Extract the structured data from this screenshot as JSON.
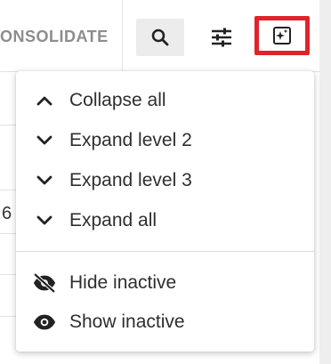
{
  "toolbar": {
    "consolidate_label": "ONSOLIDATE",
    "icons": {
      "search": "search-icon",
      "filter": "tune-icon",
      "ai": "sparkle-square-icon"
    },
    "highlight_color": "#e0232b"
  },
  "background": {
    "partial_cell_text": "6"
  },
  "menu": {
    "groups": [
      [
        {
          "label": "Collapse all",
          "icon": "chevron-up-icon"
        },
        {
          "label": "Expand level 2",
          "icon": "chevron-down-icon"
        },
        {
          "label": "Expand level 3",
          "icon": "chevron-down-icon"
        },
        {
          "label": "Expand all",
          "icon": "chevron-down-icon"
        }
      ],
      [
        {
          "label": "Hide inactive",
          "icon": "eye-off-icon"
        },
        {
          "label": "Show inactive",
          "icon": "eye-icon"
        }
      ]
    ]
  }
}
